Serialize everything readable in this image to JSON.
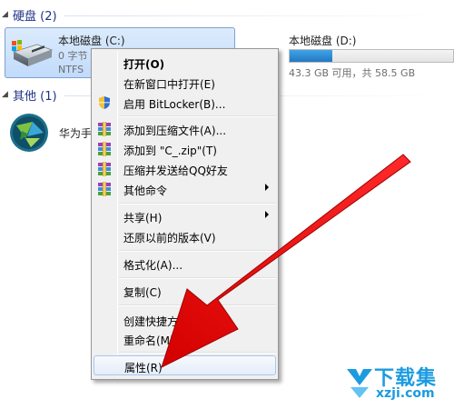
{
  "groups": {
    "hard_drives": "硬盘 (2)",
    "others": "其他 (1)"
  },
  "drives": [
    {
      "name": "本地磁盘 (C:)",
      "line1": "0 字节",
      "line2": "NTFS",
      "selected": true
    },
    {
      "name": "本地磁盘 (D:)",
      "free_text": "43.3 GB 可用，共 58.5 GB",
      "used_fraction": 0.26
    }
  ],
  "other_item": {
    "label": "华为手"
  },
  "context_menu": {
    "items": [
      {
        "label": "打开(O)",
        "bold": true
      },
      {
        "label": "在新窗口中打开(E)"
      },
      {
        "label": "启用 BitLocker(B)...",
        "icon": "shield-icon"
      },
      {
        "label": "添加到压缩文件(A)...",
        "icon": "winrar-icon"
      },
      {
        "label": "添加到 \"C_.zip\"(T)",
        "icon": "winrar-icon"
      },
      {
        "label": "压缩并发送给QQ好友",
        "icon": "winrar-icon"
      },
      {
        "label": "其他命令",
        "icon": "winrar-icon",
        "submenu": true
      },
      {
        "label": "共享(H)",
        "submenu": true
      },
      {
        "label": "还原以前的版本(V)"
      },
      {
        "label": "格式化(A)..."
      },
      {
        "label": "复制(C)"
      },
      {
        "label": "创建快捷方式"
      },
      {
        "label": "重命名(M)"
      },
      {
        "label": "属性(R)",
        "highlighted": true
      }
    ]
  },
  "watermark": {
    "main": "下载集",
    "sub": "xzji.com"
  },
  "colors": {
    "arrow": "#e8000b",
    "selection_border": "#7da2ce",
    "storage_fill": "#2478c4",
    "watermark": "#1c9be0"
  }
}
